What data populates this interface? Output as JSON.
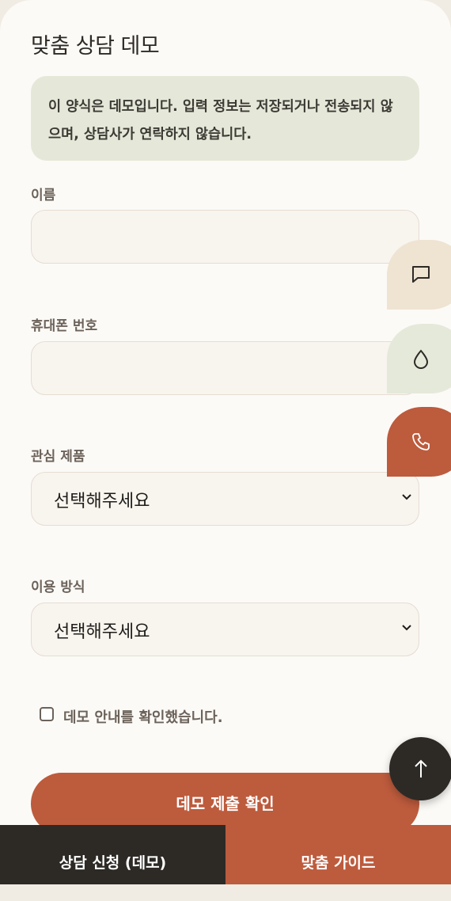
{
  "form": {
    "title": "맞춤 상담 데모",
    "notice": "이 양식은 데모입니다. 입력 정보는 저장되거나 전송되지 않으며, 상담사가 연락하지 않습니다.",
    "name_label": "이름",
    "name_value": "",
    "phone_label": "휴대폰 번호",
    "phone_value": "",
    "product_label": "관심 제품",
    "product_selected": "선택해주세요",
    "usage_label": "이용 방식",
    "usage_selected": "선택해주세요",
    "consent_label": "데모 안내를 확인했습니다.",
    "consent_checked": false,
    "submit_label": "데모 제출 확인"
  },
  "floating": {
    "icons": [
      "chat-icon",
      "drop-icon",
      "phone-icon"
    ],
    "top_icon": "arrow-up-icon"
  },
  "bottom_bar": {
    "left_label": "상담 신청 (데모)",
    "right_label": "맞춤 가이드"
  },
  "colors": {
    "accent": "#bd5b3d",
    "dark": "#2d2a26",
    "notice_bg": "#e5e8d9"
  }
}
